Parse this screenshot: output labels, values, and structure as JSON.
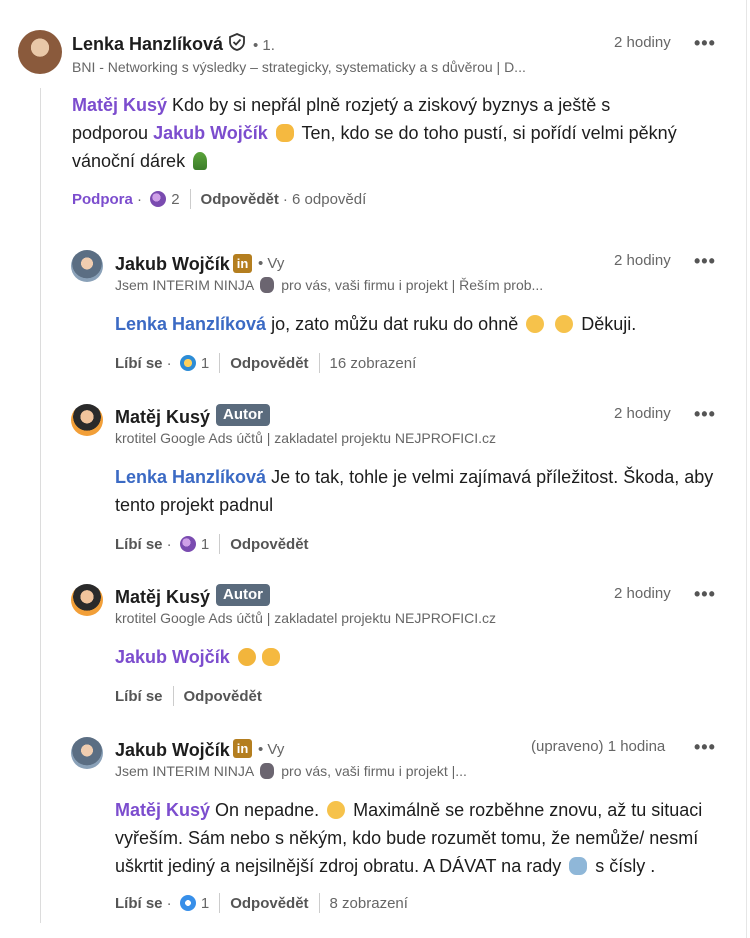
{
  "comments": [
    {
      "author": "Lenka Hanzlíková",
      "degree": "• 1.",
      "headline": "BNI - Networking s výsledky – strategicky, systematicky a s důvěrou | D...",
      "time": "2 hodiny",
      "mention1": "Matěj Kusý",
      "text1": " Kdo by si nepřál plně rozjetý a ziskový byznys a ještě s",
      "text2": "podporou ",
      "mention2": "Jakub Wojčík",
      "text3": " Ten, kdo se do toho pustí, si pořídí velmi pěkný",
      "text4": "vánoční dárek ",
      "reaction_label": "Podpora",
      "reaction_sep": " · ",
      "reaction_count": "2",
      "reply_label": "Odpovědět",
      "replies_count": "· 6 odpovědí"
    }
  ],
  "replies": [
    {
      "author": "Jakub Wojčík",
      "badge": "in",
      "degree": "• Vy",
      "headline_a": "Jsem INTERIM NINJA ",
      "headline_b": " pro vás, vaši firmu i projekt | Řeším prob...",
      "time": "2 hodiny",
      "mention": "Lenka Hanzlíková",
      "text": " jo, zato můžu dat ruku do ohně ",
      "text_end": " Děkuji.",
      "like_label": "Líbí se",
      "reaction_sep": " · ",
      "reaction_count": "1",
      "reply_label": "Odpovědět",
      "views": "16 zobrazení"
    },
    {
      "author": "Matěj Kusý",
      "autor_badge": "Autor",
      "headline": "krotitel Google Ads účtů | zakladatel projektu NEJPROFICI.cz",
      "time": "2 hodiny",
      "mention": "Lenka Hanzlíková",
      "text_line1": " Je to tak, tohle je velmi zajímavá příležitost. Škoda, aby",
      "text_line2": "tento projekt padnul",
      "like_label": "Líbí se",
      "reaction_sep": " · ",
      "reaction_count": "1",
      "reply_label": "Odpovědět"
    },
    {
      "author": "Matěj Kusý",
      "autor_badge": "Autor",
      "headline": "krotitel Google Ads účtů | zakladatel projektu NEJPROFICI.cz",
      "time": "2 hodiny",
      "mention": "Jakub Wojčík",
      "like_label": "Líbí se",
      "reply_label": "Odpovědět"
    },
    {
      "author": "Jakub Wojčík",
      "badge": "in",
      "degree": "• Vy",
      "headline_a": "Jsem INTERIM NINJA ",
      "headline_b": " pro vás, vaši firmu i projekt |...",
      "time": "(upraveno) 1 hodina",
      "mention": "Matěj Kusý",
      "text_line1": " On nepadne. ",
      "text_line1b": " Maximálně se rozběhne znovu, až tu situaci",
      "text_line2": "vyřeším. Sám nebo s někým, kdo bude rozumět tomu, že nemůže/ nesmí",
      "text_line3a": "uškrtit jediný a nejsilnější zdroj obratu. A DÁVAT na rady ",
      "text_line3b": " s čísly .",
      "like_label": "Líbí se",
      "reaction_sep": " · ",
      "reaction_count": "1",
      "reply_label": "Odpovědět",
      "views": "8 zobrazení"
    }
  ],
  "more_label": "•••",
  "colors": {
    "mention_purple": "#7c4dce",
    "mention_blue": "#3b6ac4",
    "autor_badge": "#5a6b7d",
    "linkedin_premium": "#b47e1f"
  }
}
